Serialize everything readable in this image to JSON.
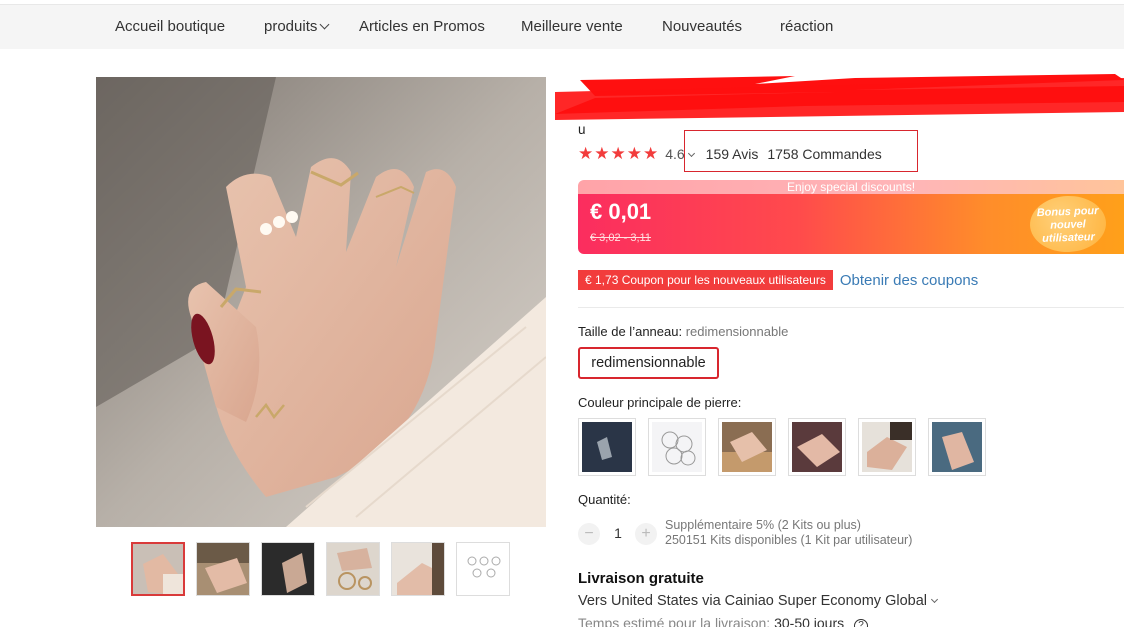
{
  "nav": {
    "items": [
      "Accueil boutique",
      "produits",
      "Articles en Promos",
      "Meilleure vente",
      "Nouveautés",
      "réaction"
    ]
  },
  "product": {
    "title_tail": "u",
    "rating": "4.6",
    "reviews": "159 Avis",
    "orders": "1758 Commandes"
  },
  "banner": {
    "top_text": "Enjoy special discounts!",
    "price": "€ 0,01",
    "old_price": "€ 3,02 - 3,11",
    "bonus_line1": "Bonus pour",
    "bonus_line2": "nouvel",
    "bonus_line3": "utilisateur"
  },
  "coupon": {
    "tag": "€ 1,73 Coupon pour les nouveaux utilisateurs",
    "link": "Obtenir des coupons"
  },
  "size": {
    "label": "Taille de l’anneau:",
    "selected": "redimensionnable",
    "option": "redimensionnable"
  },
  "color": {
    "label": "Couleur principale de pierre:"
  },
  "quantity": {
    "label": "Quantité:",
    "value": "1",
    "minus": "−",
    "plus": "+",
    "note1": "Supplémentaire 5% (2 Kits ou plus)",
    "note2": "250151 Kits disponibles (1 Kit par utilisateur)"
  },
  "shipping": {
    "title": "Livraison gratuite",
    "destination": "Vers United States via Cainiao Super Economy Global",
    "time_label": "Temps estimé pour la livraison:",
    "time_value": "30-50 jours"
  },
  "colors": {
    "accent_red": "#d8262e",
    "link_blue": "#3a7bb5",
    "star_red": "#f23c3c"
  }
}
